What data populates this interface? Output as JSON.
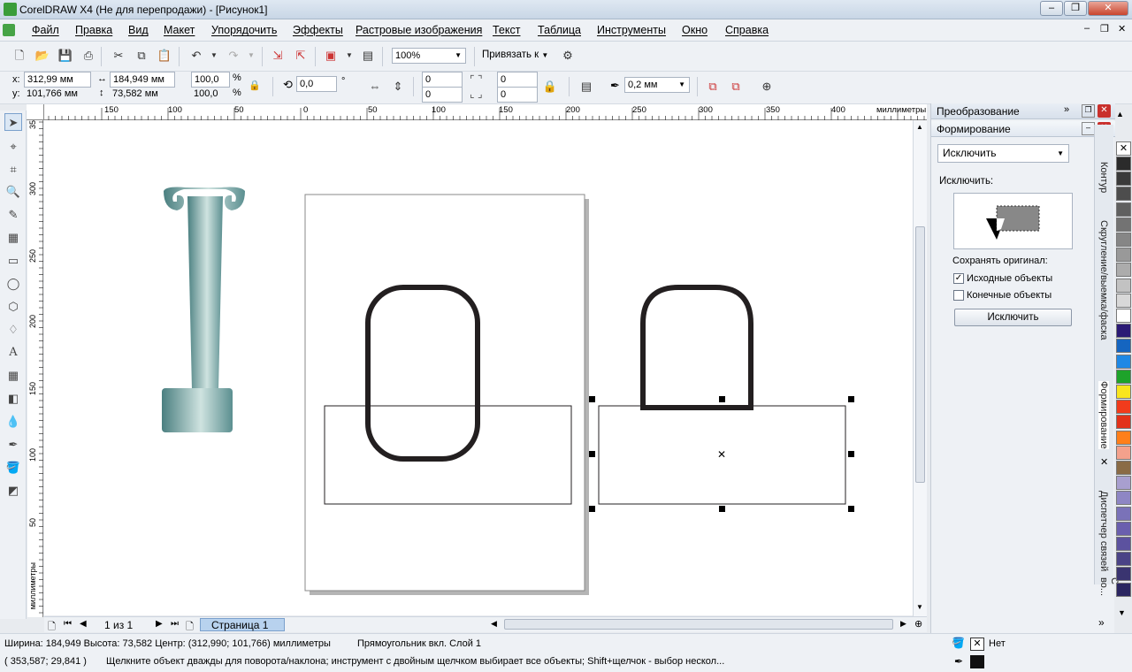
{
  "window": {
    "title": "CorelDRAW X4 (Не для перепродажи) - [Рисунок1]"
  },
  "menu": [
    "Файл",
    "Правка",
    "Вид",
    "Макет",
    "Упорядочить",
    "Эффекты",
    "Растровые изображения",
    "Текст",
    "Таблица",
    "Инструменты",
    "Окно",
    "Справка"
  ],
  "standard_toolbar": {
    "zoom": "100%",
    "snap": "Привязать к"
  },
  "property_bar": {
    "x": "312,99 мм",
    "y": "101,766 мм",
    "width": "184,949 мм",
    "height": "73,582 мм",
    "scale_x": "100,0",
    "scale_y": "100,0",
    "percent": "%",
    "rotation": "0,0",
    "degree": "°",
    "corner_values": [
      "0",
      "0",
      "0",
      "0"
    ],
    "outline_width": "0,2 мм"
  },
  "ruler": {
    "h_ticks": [
      "150",
      "100",
      "50",
      "0",
      "50",
      "100",
      "150",
      "200",
      "250",
      "300",
      "350",
      "400"
    ],
    "h_unit": "миллиметры",
    "v_ticks": [
      "35",
      "300",
      "250",
      "200",
      "150",
      "100",
      "50"
    ],
    "v_unit": "миллиметры"
  },
  "page_nav": {
    "counter": "1 из 1",
    "page_tab": "Страница 1"
  },
  "docker": {
    "transform_title": "Преобразование",
    "shaping_title": "Формирование",
    "mode": "Исключить",
    "mode_label": "Исключить:",
    "keep_label": "Сохранять оригинал:",
    "source_objects": "Исходные объекты",
    "target_objects": "Конечные объекты",
    "source_checked": true,
    "target_checked": false,
    "apply_button": "Исключить",
    "side_tabs": [
      "Контур",
      "Скругление/выемка/фаска",
      "Формирование",
      "Диспетчер связей",
      "С во..."
    ]
  },
  "palette": [
    "#ffffff",
    "#2b2b2b",
    "#3a3a3a",
    "#4d4d4d",
    "#606060",
    "#737373",
    "#868686",
    "#999999",
    "#acacac",
    "#c2c2c2",
    "#d8d8d8",
    "#ffffff",
    "#2b1a75",
    "#1565c0",
    "#1e88e5",
    "#1ea32a",
    "#f9e51e",
    "#f13b1c",
    "#e2321a",
    "#ff7f1a",
    "#f4a18c",
    "#8a6b46",
    "#a89fcf",
    "#8e86c4",
    "#7a72b8",
    "#6a5fae",
    "#5c529f",
    "#4a4386",
    "#3a3470",
    "#2a2560"
  ],
  "status": {
    "line1": "Ширина: 184,949 Высота: 73,582 Центр: (312,990; 101,766)  миллиметры",
    "line1_obj": "Прямоугольник вкл. Слой 1",
    "line2_coords": "( 353,587; 29,841 )",
    "line2_hint": "Щелкните объект дважды для поворота/наклона; инструмент с двойным щелчком выбирает все объекты; Shift+щелчок - выбор нескол...",
    "fill": "Нет"
  }
}
